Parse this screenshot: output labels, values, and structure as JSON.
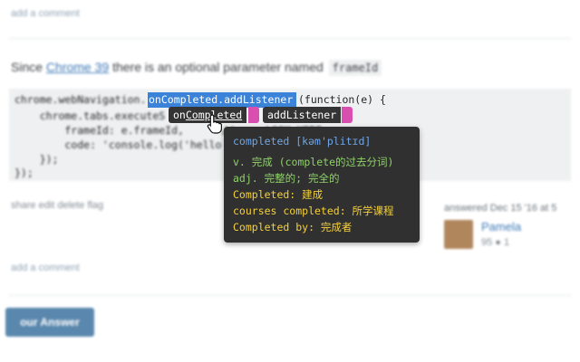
{
  "page": {
    "add_comment_top": "add a comment",
    "intro": {
      "before": "Since ",
      "link": "Chrome 39",
      "after": " there is an optional parameter named ",
      "param": "frameId"
    },
    "code": {
      "line1_prefix": "chrome.webNavigation.",
      "line1_selected": "onCompleted.addListener",
      "line1_suffix": "(function(e) {",
      "line2": "    chrome.tabs.executeS",
      "line3": "        frameId: e.frameId,      // <== LOOK HERE",
      "line4": "        code: 'console.log('hello",
      "line5": "    });",
      "line6": "});"
    },
    "post_menu": "share  edit  delete  flag",
    "answered": "answered Dec 15 '16 at 5",
    "user_name": "Pamela",
    "user_rep": "95 ● 1",
    "add_comment_bottom": "add a comment",
    "answer_button": "our Answer"
  },
  "tokens": [
    {
      "pre": "on",
      "split": "Completed"
    },
    {
      "pre": "addListener",
      "split": ""
    }
  ],
  "popup": {
    "word": "completed",
    "phonetic": "[kəm'plitɪd]",
    "definition_1": "v. 完成 (complete的过去分词)",
    "definition_2": "adj. 完整的; 完全的",
    "examples": [
      "Completed: 建成",
      "courses completed: 所学课程",
      "Completed by: 完成者"
    ]
  },
  "colors": {
    "selection": "#3b83d8",
    "popup_bg": "#303030",
    "chip_tab": "#d94fb0",
    "word": "#6fa6e8",
    "definition": "#8fd16a",
    "example": "#f5d03a"
  },
  "icons": {
    "cursor": "hand-pointer-icon"
  }
}
